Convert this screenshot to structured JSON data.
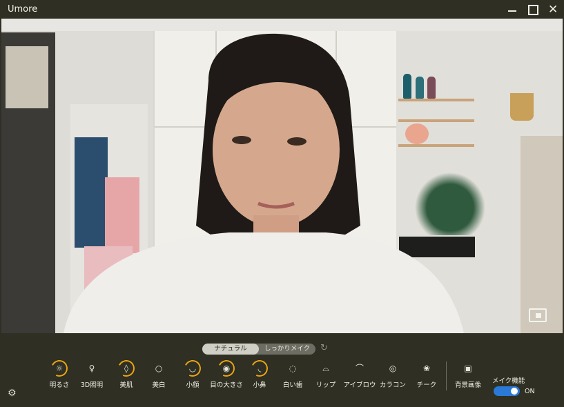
{
  "window": {
    "title": "Umore"
  },
  "titlebar_icons": [
    "minimize-icon",
    "maximize-icon",
    "close-icon"
  ],
  "mode": {
    "natural": "ナチュラル",
    "full": "しっかりメイク",
    "selected": "natural"
  },
  "tools": [
    {
      "label": "明るさ",
      "icon": "brightness-icon",
      "active": true
    },
    {
      "label": "3D照明",
      "icon": "3d-lighting-icon",
      "active": false
    },
    {
      "label": "美肌",
      "icon": "smooth-skin-icon",
      "active": true
    },
    {
      "label": "美白",
      "icon": "whitening-icon",
      "active": false
    },
    {
      "label": "小顔",
      "icon": "slim-face-icon",
      "active": true
    },
    {
      "label": "目の大きさ",
      "icon": "eye-size-icon",
      "active": true
    },
    {
      "label": "小鼻",
      "icon": "nose-icon",
      "active": true
    },
    {
      "label": "白い歯",
      "icon": "white-teeth-icon",
      "active": false
    },
    {
      "label": "リップ",
      "icon": "lip-icon",
      "active": false
    },
    {
      "label": "アイブロウ",
      "icon": "eyebrow-icon",
      "active": false
    },
    {
      "label": "カラコン",
      "icon": "color-contact-icon",
      "active": false
    },
    {
      "label": "チーク",
      "icon": "cheek-icon",
      "active": false
    },
    {
      "label": "背景画像",
      "icon": "background-image-icon",
      "active": false
    }
  ],
  "makeup": {
    "title": "メイク機能",
    "state": "ON",
    "enabled": true
  },
  "colors": {
    "accent": "#e9a414",
    "switch": "#2a79d6",
    "background": "#2f2f23"
  }
}
